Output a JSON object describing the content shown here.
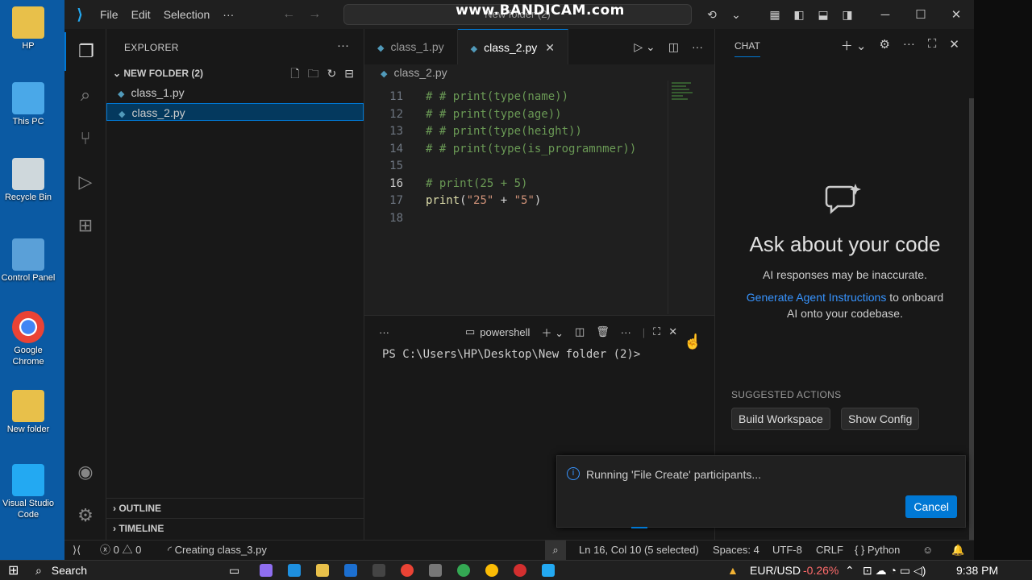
{
  "desktop_icons": [
    {
      "label": "HP",
      "icon": "user-folder-icon",
      "color": "#e8c04a"
    },
    {
      "label": "This PC",
      "icon": "computer-icon",
      "color": "#4aa8e8"
    },
    {
      "label": "Recycle Bin",
      "icon": "recycle-bin-icon",
      "color": "#cfd8dc"
    },
    {
      "label": "Control Panel",
      "icon": "control-panel-icon",
      "color": "#5aa0d8"
    },
    {
      "label": "Google Chrome",
      "icon": "chrome-icon",
      "color": "#ea4335"
    },
    {
      "label": "New folder",
      "icon": "folder-icon",
      "color": "#e8c04a"
    },
    {
      "label": "Visual Studio Code",
      "icon": "vscode-icon",
      "color": "#23a9f2"
    }
  ],
  "titlebar": {
    "menu": [
      "File",
      "Edit",
      "Selection"
    ],
    "more": "···",
    "command_center": "New folder (2)",
    "watermark": "www.BANDICAM.com"
  },
  "explorer": {
    "title": "EXPLORER",
    "folder": "NEW FOLDER (2)",
    "files": [
      "class_1.py",
      "class_2.py"
    ],
    "outline": "OUTLINE",
    "timeline": "TIMELINE"
  },
  "editor": {
    "tabs": [
      "class_1.py",
      "class_2.py"
    ],
    "active_tab": "class_2.py",
    "breadcrumb": "class_2.py",
    "lines": [
      {
        "n": "11",
        "parts": [
          {
            "c": "cmt",
            "t": "# # print(type(name))"
          }
        ]
      },
      {
        "n": "12",
        "parts": [
          {
            "c": "cmt",
            "t": "# # print(type(age))"
          }
        ]
      },
      {
        "n": "13",
        "parts": [
          {
            "c": "cmt",
            "t": "# # print(type(height))"
          }
        ]
      },
      {
        "n": "14",
        "parts": [
          {
            "c": "cmt",
            "t": "# # print(type(is_programnmer))"
          }
        ]
      },
      {
        "n": "15",
        "parts": []
      },
      {
        "n": "16",
        "parts": [
          {
            "c": "cmt",
            "t": "# print(25 + 5)"
          }
        ]
      },
      {
        "n": "17",
        "parts": [
          {
            "c": "fn",
            "t": "print"
          },
          {
            "c": "op",
            "t": "("
          },
          {
            "c": "str",
            "t": "\"25\""
          },
          {
            "c": "op",
            "t": " + "
          },
          {
            "c": "str",
            "t": "\"5\""
          },
          {
            "c": "op",
            "t": ")"
          }
        ]
      },
      {
        "n": "18",
        "parts": []
      }
    ],
    "current_line": "16"
  },
  "terminal": {
    "shell": "powershell",
    "prompt": "PS C:\\Users\\HP\\Desktop\\New folder (2)>"
  },
  "chat": {
    "title": "CHAT",
    "heading": "Ask about your code",
    "subtitle": "AI responses may be inaccurate.",
    "link": "Generate Agent Instructions",
    "link_suffix": " to onboard",
    "line2": "AI onto your codebase.",
    "suggested_label": "SUGGESTED ACTIONS",
    "suggestions": [
      "Build Workspace",
      "Show Config"
    ]
  },
  "notification": {
    "text": "Running 'File Create' participants...",
    "cancel": "Cancel"
  },
  "statusbar": {
    "errors": "0",
    "warnings": "0",
    "task": "Creating class_3.py",
    "position": "Ln 16, Col 10 (5 selected)",
    "spaces": "Spaces: 4",
    "encoding": "UTF-8",
    "eol": "CRLF",
    "language": "Python"
  },
  "taskbar": {
    "search": "Search",
    "ticker": "EUR/USD",
    "change": "-0.26%",
    "time": "9:38 PM",
    "accent_negative": "#ff6b6b"
  }
}
